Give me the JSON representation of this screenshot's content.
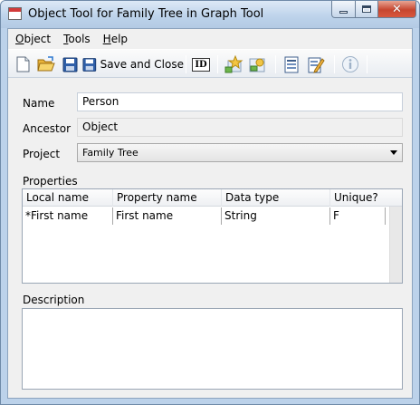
{
  "window": {
    "title": "Object Tool for Family Tree in Graph Tool"
  },
  "menu": {
    "items": [
      {
        "label": "Object",
        "accel": "O",
        "rest": "bject"
      },
      {
        "label": "Tools",
        "accel": "T",
        "rest": "ools"
      },
      {
        "label": "Help",
        "accel": "H",
        "rest": "elp"
      }
    ]
  },
  "toolbar": {
    "save_and_close_label": "Save and Close",
    "id_label": "ID",
    "icons": [
      "new-document-icon",
      "open-folder-icon",
      "save-icon",
      "save-and-close-icon",
      "id-icon",
      "add-properties-icon",
      "edit-properties-icon",
      "form-icon",
      "edit-form-icon",
      "info-icon"
    ]
  },
  "form": {
    "name_label": "Name",
    "name_value": "Person",
    "ancestor_label": "Ancestor",
    "ancestor_value": "Object",
    "project_label": "Project",
    "project_value": "Family Tree"
  },
  "properties": {
    "section_label": "Properties",
    "columns": [
      "Local name",
      "Property name",
      "Data type",
      "Unique?"
    ],
    "rows": [
      [
        "*First name",
        "First name",
        "String",
        "F"
      ]
    ]
  },
  "description": {
    "section_label": "Description",
    "value": ""
  }
}
